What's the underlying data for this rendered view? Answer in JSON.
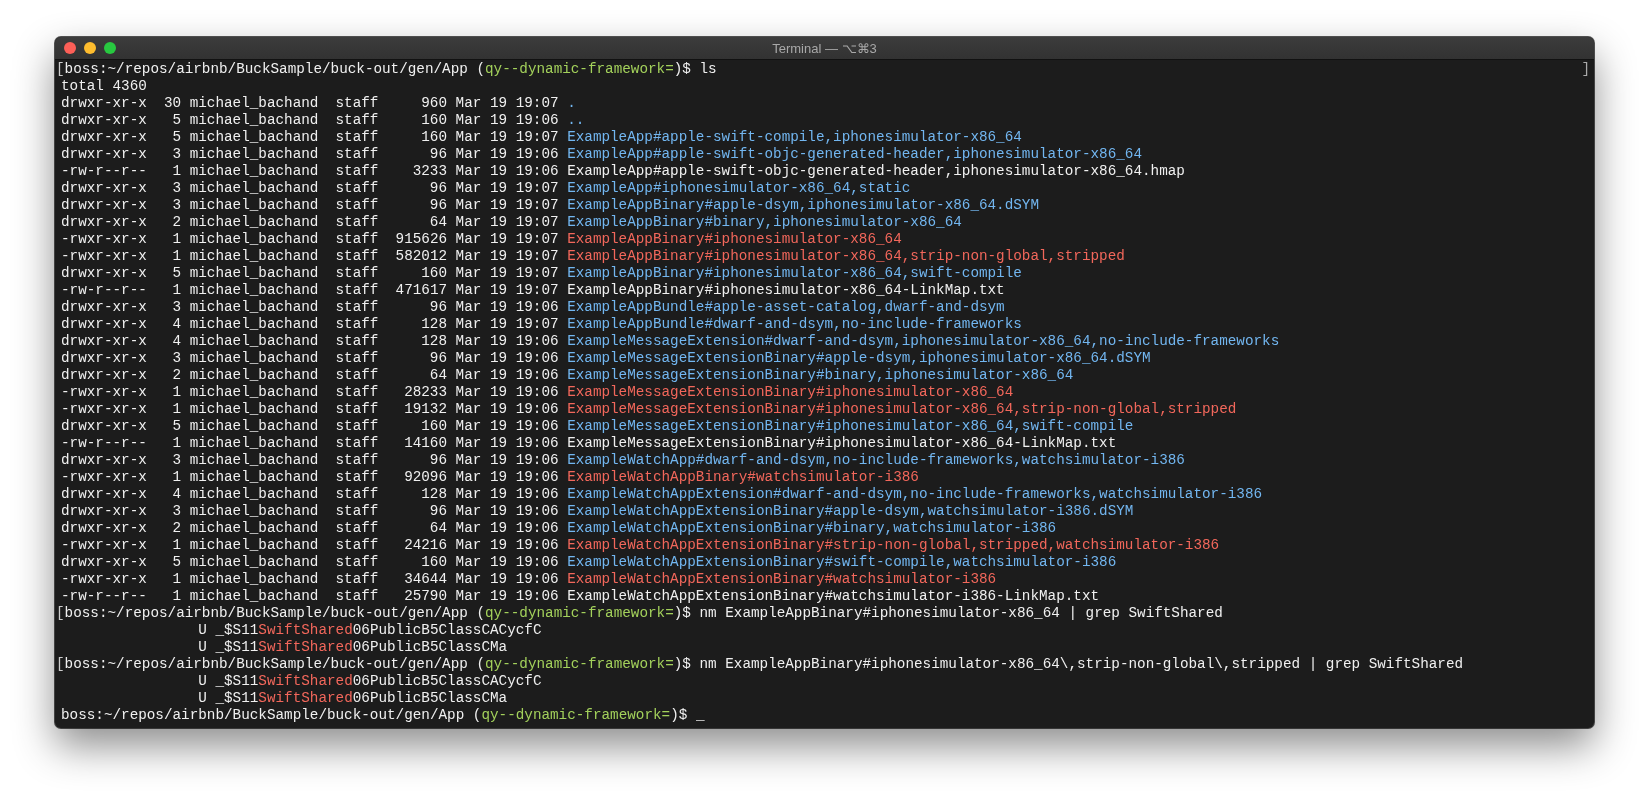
{
  "window": {
    "title": "Terminal — ⌥⌘3"
  },
  "lines": [
    {
      "kind": "prompt",
      "mark_left": "[",
      "mark_right": "]",
      "before": "boss:~/repos/airbnb/BuckSample/buck-out/gen/App (",
      "branch": "qy--dynamic-framework=",
      "after": ")$",
      "command": "ls"
    },
    {
      "kind": "text",
      "text": "total 4360"
    },
    {
      "kind": "dir",
      "mode": "drwxr-xr-x",
      "links": "30",
      "owner": "michael_bachand",
      "group": "staff",
      "size": "960",
      "date": "Mar 19 19:07",
      "name": "."
    },
    {
      "kind": "dir",
      "mode": "drwxr-xr-x",
      "links": "5",
      "owner": "michael_bachand",
      "group": "staff",
      "size": "160",
      "date": "Mar 19 19:06",
      "name": ".."
    },
    {
      "kind": "dir",
      "mode": "drwxr-xr-x",
      "links": "5",
      "owner": "michael_bachand",
      "group": "staff",
      "size": "160",
      "date": "Mar 19 19:07",
      "name": "ExampleApp#apple-swift-compile,iphonesimulator-x86_64"
    },
    {
      "kind": "dir",
      "mode": "drwxr-xr-x",
      "links": "3",
      "owner": "michael_bachand",
      "group": "staff",
      "size": "96",
      "date": "Mar 19 19:06",
      "name": "ExampleApp#apple-swift-objc-generated-header,iphonesimulator-x86_64"
    },
    {
      "kind": "file",
      "mode": "-rw-r--r--",
      "links": "1",
      "owner": "michael_bachand",
      "group": "staff",
      "size": "3233",
      "date": "Mar 19 19:06",
      "name": "ExampleApp#apple-swift-objc-generated-header,iphonesimulator-x86_64.hmap"
    },
    {
      "kind": "dir",
      "mode": "drwxr-xr-x",
      "links": "3",
      "owner": "michael_bachand",
      "group": "staff",
      "size": "96",
      "date": "Mar 19 19:07",
      "name": "ExampleApp#iphonesimulator-x86_64,static"
    },
    {
      "kind": "dir",
      "mode": "drwxr-xr-x",
      "links": "3",
      "owner": "michael_bachand",
      "group": "staff",
      "size": "96",
      "date": "Mar 19 19:07",
      "name": "ExampleAppBinary#apple-dsym,iphonesimulator-x86_64.dSYM"
    },
    {
      "kind": "dir",
      "mode": "drwxr-xr-x",
      "links": "2",
      "owner": "michael_bachand",
      "group": "staff",
      "size": "64",
      "date": "Mar 19 19:07",
      "name": "ExampleAppBinary#binary,iphonesimulator-x86_64"
    },
    {
      "kind": "exec",
      "mode": "-rwxr-xr-x",
      "links": "1",
      "owner": "michael_bachand",
      "group": "staff",
      "size": "915626",
      "date": "Mar 19 19:07",
      "name": "ExampleAppBinary#iphonesimulator-x86_64"
    },
    {
      "kind": "exec",
      "mode": "-rwxr-xr-x",
      "links": "1",
      "owner": "michael_bachand",
      "group": "staff",
      "size": "582012",
      "date": "Mar 19 19:07",
      "name": "ExampleAppBinary#iphonesimulator-x86_64,strip-non-global,stripped"
    },
    {
      "kind": "dir",
      "mode": "drwxr-xr-x",
      "links": "5",
      "owner": "michael_bachand",
      "group": "staff",
      "size": "160",
      "date": "Mar 19 19:07",
      "name": "ExampleAppBinary#iphonesimulator-x86_64,swift-compile"
    },
    {
      "kind": "file",
      "mode": "-rw-r--r--",
      "links": "1",
      "owner": "michael_bachand",
      "group": "staff",
      "size": "471617",
      "date": "Mar 19 19:07",
      "name": "ExampleAppBinary#iphonesimulator-x86_64-LinkMap.txt"
    },
    {
      "kind": "dir",
      "mode": "drwxr-xr-x",
      "links": "3",
      "owner": "michael_bachand",
      "group": "staff",
      "size": "96",
      "date": "Mar 19 19:06",
      "name": "ExampleAppBundle#apple-asset-catalog,dwarf-and-dsym"
    },
    {
      "kind": "dir",
      "mode": "drwxr-xr-x",
      "links": "4",
      "owner": "michael_bachand",
      "group": "staff",
      "size": "128",
      "date": "Mar 19 19:07",
      "name": "ExampleAppBundle#dwarf-and-dsym,no-include-frameworks"
    },
    {
      "kind": "dir",
      "mode": "drwxr-xr-x",
      "links": "4",
      "owner": "michael_bachand",
      "group": "staff",
      "size": "128",
      "date": "Mar 19 19:06",
      "name": "ExampleMessageExtension#dwarf-and-dsym,iphonesimulator-x86_64,no-include-frameworks"
    },
    {
      "kind": "dir",
      "mode": "drwxr-xr-x",
      "links": "3",
      "owner": "michael_bachand",
      "group": "staff",
      "size": "96",
      "date": "Mar 19 19:06",
      "name": "ExampleMessageExtensionBinary#apple-dsym,iphonesimulator-x86_64.dSYM"
    },
    {
      "kind": "dir",
      "mode": "drwxr-xr-x",
      "links": "2",
      "owner": "michael_bachand",
      "group": "staff",
      "size": "64",
      "date": "Mar 19 19:06",
      "name": "ExampleMessageExtensionBinary#binary,iphonesimulator-x86_64"
    },
    {
      "kind": "exec",
      "mode": "-rwxr-xr-x",
      "links": "1",
      "owner": "michael_bachand",
      "group": "staff",
      "size": "28233",
      "date": "Mar 19 19:06",
      "name": "ExampleMessageExtensionBinary#iphonesimulator-x86_64"
    },
    {
      "kind": "exec",
      "mode": "-rwxr-xr-x",
      "links": "1",
      "owner": "michael_bachand",
      "group": "staff",
      "size": "19132",
      "date": "Mar 19 19:06",
      "name": "ExampleMessageExtensionBinary#iphonesimulator-x86_64,strip-non-global,stripped"
    },
    {
      "kind": "dir",
      "mode": "drwxr-xr-x",
      "links": "5",
      "owner": "michael_bachand",
      "group": "staff",
      "size": "160",
      "date": "Mar 19 19:06",
      "name": "ExampleMessageExtensionBinary#iphonesimulator-x86_64,swift-compile"
    },
    {
      "kind": "file",
      "mode": "-rw-r--r--",
      "links": "1",
      "owner": "michael_bachand",
      "group": "staff",
      "size": "14160",
      "date": "Mar 19 19:06",
      "name": "ExampleMessageExtensionBinary#iphonesimulator-x86_64-LinkMap.txt"
    },
    {
      "kind": "dir",
      "mode": "drwxr-xr-x",
      "links": "3",
      "owner": "michael_bachand",
      "group": "staff",
      "size": "96",
      "date": "Mar 19 19:06",
      "name": "ExampleWatchApp#dwarf-and-dsym,no-include-frameworks,watchsimulator-i386"
    },
    {
      "kind": "exec",
      "mode": "-rwxr-xr-x",
      "links": "1",
      "owner": "michael_bachand",
      "group": "staff",
      "size": "92096",
      "date": "Mar 19 19:06",
      "name": "ExampleWatchAppBinary#watchsimulator-i386"
    },
    {
      "kind": "dir",
      "mode": "drwxr-xr-x",
      "links": "4",
      "owner": "michael_bachand",
      "group": "staff",
      "size": "128",
      "date": "Mar 19 19:06",
      "name": "ExampleWatchAppExtension#dwarf-and-dsym,no-include-frameworks,watchsimulator-i386"
    },
    {
      "kind": "dir",
      "mode": "drwxr-xr-x",
      "links": "3",
      "owner": "michael_bachand",
      "group": "staff",
      "size": "96",
      "date": "Mar 19 19:06",
      "name": "ExampleWatchAppExtensionBinary#apple-dsym,watchsimulator-i386.dSYM"
    },
    {
      "kind": "dir",
      "mode": "drwxr-xr-x",
      "links": "2",
      "owner": "michael_bachand",
      "group": "staff",
      "size": "64",
      "date": "Mar 19 19:06",
      "name": "ExampleWatchAppExtensionBinary#binary,watchsimulator-i386"
    },
    {
      "kind": "exec",
      "mode": "-rwxr-xr-x",
      "links": "1",
      "owner": "michael_bachand",
      "group": "staff",
      "size": "24216",
      "date": "Mar 19 19:06",
      "name": "ExampleWatchAppExtensionBinary#strip-non-global,stripped,watchsimulator-i386"
    },
    {
      "kind": "dir",
      "mode": "drwxr-xr-x",
      "links": "5",
      "owner": "michael_bachand",
      "group": "staff",
      "size": "160",
      "date": "Mar 19 19:06",
      "name": "ExampleWatchAppExtensionBinary#swift-compile,watchsimulator-i386"
    },
    {
      "kind": "exec",
      "mode": "-rwxr-xr-x",
      "links": "1",
      "owner": "michael_bachand",
      "group": "staff",
      "size": "34644",
      "date": "Mar 19 19:06",
      "name": "ExampleWatchAppExtensionBinary#watchsimulator-i386"
    },
    {
      "kind": "file",
      "mode": "-rw-r--r--",
      "links": "1",
      "owner": "michael_bachand",
      "group": "staff",
      "size": "25790",
      "date": "Mar 19 19:06",
      "name": "ExampleWatchAppExtensionBinary#watchsimulator-i386-LinkMap.txt"
    },
    {
      "kind": "prompt",
      "mark_left": "[",
      "before": "boss:~/repos/airbnb/BuckSample/buck-out/gen/App (",
      "branch": "qy--dynamic-framework=",
      "after": ")$",
      "command": "nm ExampleAppBinary#iphonesimulator-x86_64 | grep SwiftShared"
    },
    {
      "kind": "symbol",
      "type": "U",
      "prefix": "_$S11",
      "module": "SwiftShared",
      "suffix": "06PublicB5ClassCACycfC"
    },
    {
      "kind": "symbol",
      "type": "U",
      "prefix": "_$S11",
      "module": "SwiftShared",
      "suffix": "06PublicB5ClassCMa"
    },
    {
      "kind": "prompt",
      "mark_left": "[",
      "before": "boss:~/repos/airbnb/BuckSample/buck-out/gen/App (",
      "branch": "qy--dynamic-framework=",
      "after": ")$",
      "command": "nm ExampleAppBinary#iphonesimulator-x86_64\\,strip-non-global\\,stripped | grep SwiftShared"
    },
    {
      "kind": "symbol",
      "type": "U",
      "prefix": "_$S11",
      "module": "SwiftShared",
      "suffix": "06PublicB5ClassCACycfC"
    },
    {
      "kind": "symbol",
      "type": "U",
      "prefix": "_$S11",
      "module": "SwiftShared",
      "suffix": "06PublicB5ClassCMa"
    },
    {
      "kind": "prompt",
      "before": "boss:~/repos/airbnb/BuckSample/buck-out/gen/App (",
      "branch": "qy--dynamic-framework=",
      "after": ")$",
      "cursor": "_"
    }
  ]
}
